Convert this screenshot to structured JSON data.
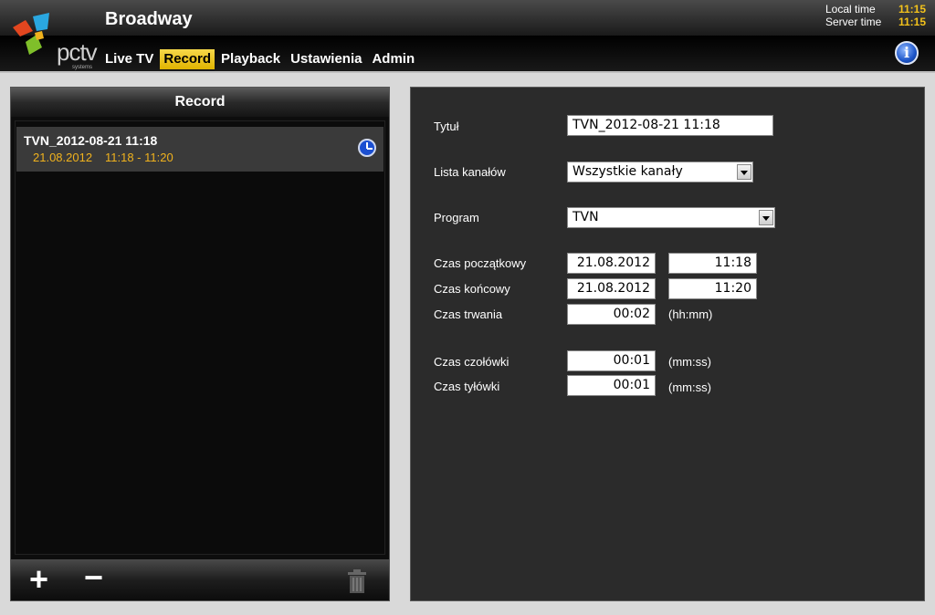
{
  "app": {
    "title": "Broadway",
    "logo_text": "pctv",
    "logo_sub": "systems"
  },
  "nav": {
    "items": [
      {
        "label": "Live TV",
        "active": false
      },
      {
        "label": "Record",
        "active": true
      },
      {
        "label": "Playback",
        "active": false
      },
      {
        "label": "Ustawienia",
        "active": false
      },
      {
        "label": "Admin",
        "active": false
      }
    ]
  },
  "clock": {
    "local_label": "Local time",
    "local_value": "11:15",
    "server_label": "Server time",
    "server_value": "11:15"
  },
  "left": {
    "header": "Record",
    "items": [
      {
        "title": "TVN_2012-08-21 11:18",
        "date": "21.08.2012",
        "time": "11:18 - 11:20",
        "icon": "clock-icon"
      }
    ],
    "footer": {
      "add": "+",
      "remove": "−",
      "delete_icon": "trash-icon"
    }
  },
  "form": {
    "title_label": "Tytuł",
    "title_value": "TVN_2012-08-21 11:18",
    "channels_label": "Lista kanałów",
    "channels_value": "Wszystkie kanały",
    "program_label": "Program",
    "program_value": "TVN",
    "start_label": "Czas początkowy",
    "start_date": "21.08.2012",
    "start_time": "11:18",
    "end_label": "Czas końcowy",
    "end_date": "21.08.2012",
    "end_time": "11:20",
    "duration_label": "Czas trwania",
    "duration_value": "00:02",
    "duration_unit": "(hh:mm)",
    "lead_label": "Czas czołówki",
    "lead_value": "00:01",
    "lead_unit": "(mm:ss)",
    "tail_label": "Czas tyłówki",
    "tail_value": "00:01",
    "tail_unit": "(mm:ss)"
  },
  "colors": {
    "accent": "#f0b21d",
    "nav_active": "#f1c40f",
    "info_blue": "#1d55c8"
  }
}
